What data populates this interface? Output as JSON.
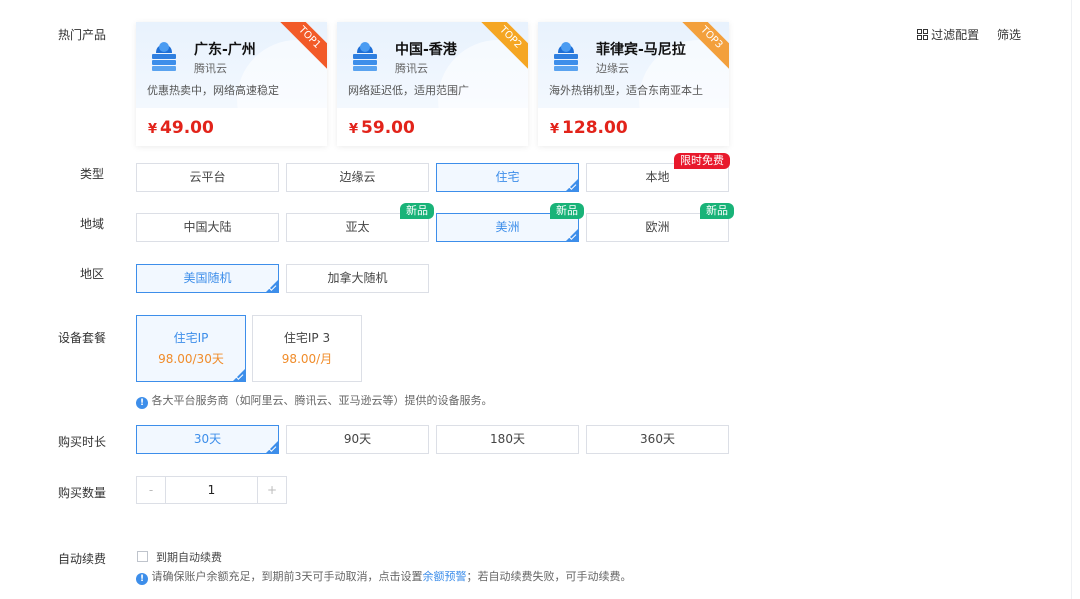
{
  "toolbar": {
    "filter_config": "过滤配置",
    "filter": "筛选"
  },
  "labels": {
    "hot": "热门产品",
    "type": "类型",
    "region": "地域",
    "area": "地区",
    "plan": "设备套餐",
    "duration": "购买时长",
    "quantity": "购买数量",
    "renew": "自动续费"
  },
  "products": [
    {
      "name": "广东-广州",
      "vendor": "腾讯云",
      "desc": "优惠热卖中，网络高速稳定",
      "currency": "¥",
      "price": "49.00",
      "rank": "TOP1"
    },
    {
      "name": "中国-香港",
      "vendor": "腾讯云",
      "desc": "网络延迟低，适用范围广",
      "currency": "¥",
      "price": "59.00",
      "rank": "TOP2"
    },
    {
      "name": "菲律宾-马尼拉",
      "vendor": "边缘云",
      "desc": "海外热销机型，适合东南亚本土",
      "currency": "¥",
      "price": "128.00",
      "rank": "TOP3"
    }
  ],
  "types": [
    {
      "label": "云平台"
    },
    {
      "label": "边缘云"
    },
    {
      "label": "住宅"
    },
    {
      "label": "本地",
      "badge": "限时免费"
    }
  ],
  "regions": [
    {
      "label": "中国大陆"
    },
    {
      "label": "亚太",
      "badge": "新品"
    },
    {
      "label": "美洲",
      "badge": "新品"
    },
    {
      "label": "欧洲",
      "badge": "新品"
    }
  ],
  "areas": [
    {
      "label": "美国随机"
    },
    {
      "label": "加拿大随机"
    }
  ],
  "plans": [
    {
      "name": "住宅IP",
      "price": "98.00/30天"
    },
    {
      "name": "住宅IP 3",
      "price": "98.00/月"
    }
  ],
  "plan_note": "各大平台服务商（如阿里云、腾讯云、亚马逊云等）提供的设备服务。",
  "durations": [
    {
      "label": "30天"
    },
    {
      "label": "90天"
    },
    {
      "label": "180天"
    },
    {
      "label": "360天"
    }
  ],
  "quantity": {
    "minus": "-",
    "value": "1",
    "plus": "+"
  },
  "renew": {
    "checkbox_label": "到期自动续费",
    "note_before": "请确保账户余额充足，到期前3天可手动取消，点击设置",
    "note_link": "余额预警",
    "note_after": "；若自动续费失败，可手动续费。"
  },
  "info_glyph": "!",
  "colors": {
    "accent": "#3d8eea",
    "price": "#e2231a",
    "new_badge": "#19b378",
    "free_badge": "#e8192c",
    "plan_price": "#f08c2a"
  }
}
